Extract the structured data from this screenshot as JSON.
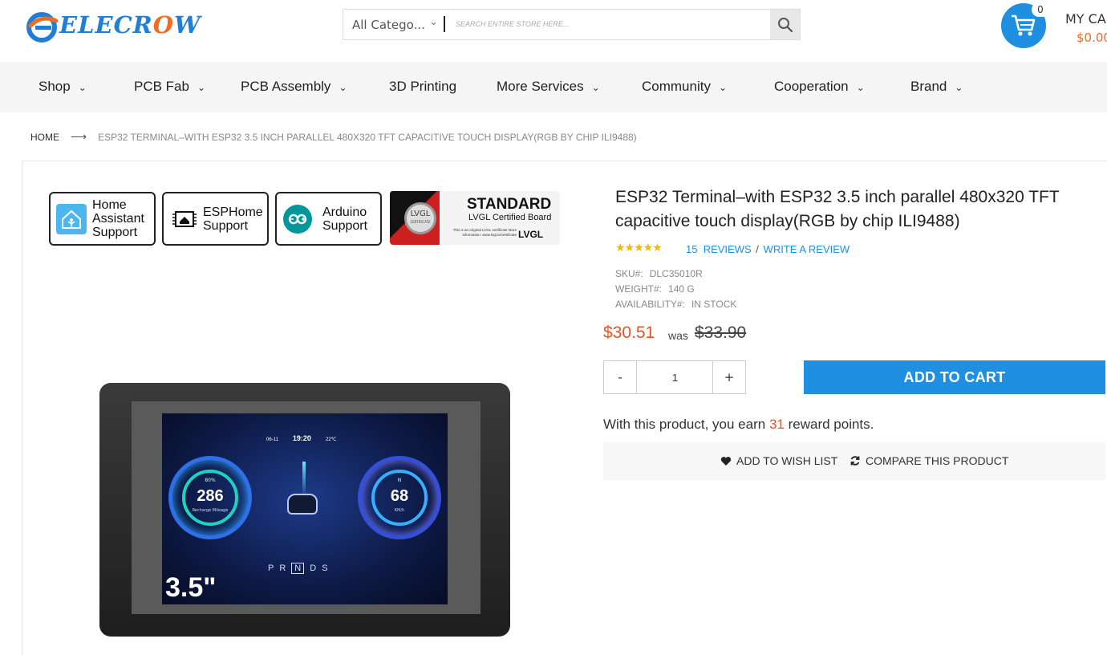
{
  "brand": {
    "logo_text_pre": "ELECR",
    "logo_text_o": "O",
    "logo_text_post": "W",
    "accent": "#1e8fe1",
    "orange": "#f26a21"
  },
  "search": {
    "category": "All Catego...",
    "placeholder": "SEARCH ENTIRE STORE HERE..."
  },
  "cart": {
    "count": "0",
    "label": "MY CA",
    "total": "$0.00"
  },
  "nav": [
    {
      "label": "Shop",
      "has_menu": true
    },
    {
      "label": "PCB Fab",
      "has_menu": true
    },
    {
      "label": "PCB Assembly",
      "has_menu": true
    },
    {
      "label": "3D Printing",
      "has_menu": false
    },
    {
      "label": "More Services",
      "has_menu": true
    },
    {
      "label": "Community",
      "has_menu": true
    },
    {
      "label": "Cooperation",
      "has_menu": true
    },
    {
      "label": "Brand",
      "has_menu": true
    }
  ],
  "breadcrumb": {
    "home": "HOME",
    "current": "ESP32 TERMINAL–WITH ESP32 3.5 INCH PARALLEL 480X320 TFT CAPACITIVE TOUCH DISPLAY(RGB BY CHIP ILI9488)"
  },
  "badges": [
    {
      "icon": "home-assistant-icon",
      "line1": "Home",
      "line2": "Assistant",
      "line3": "Support"
    },
    {
      "icon": "esphome-icon",
      "line1": "ESPHome",
      "line2": "Support"
    },
    {
      "icon": "arduino-icon",
      "line1": "Arduino",
      "line2": "Support"
    }
  ],
  "lvgl_badge": {
    "circle": "LVGL",
    "circle_sub": "CERTIFICATE",
    "title": "STANDARD",
    "subtitle": "LVGL Certified Board",
    "fine_print": "This is an original LVGL certificate More information: www.lvgl.io/certificate",
    "brand": "LVGL"
  },
  "device_screen": {
    "date": "06-11",
    "time": "19:20",
    "temp": "22℃",
    "left_value": "286",
    "left_pct": "80%",
    "left_sub": "Recharge Mileage",
    "right_value": "68",
    "right_top": "N",
    "right_sub": "KM/h",
    "gear_p": "P",
    "gear_r": "R",
    "gear_n": "N",
    "gear_d": "D",
    "gear_s": "S",
    "size_label": "3.5\""
  },
  "product": {
    "title": "ESP32 Terminal–with ESP32 3.5 inch parallel 480x320 TFT capacitive touch display(RGB by chip ILI9488)",
    "rating": 5,
    "stars": "★★★★★",
    "reviews_count": "15",
    "reviews_label": "REVIEWS",
    "separator": "/",
    "write_review": "WRITE A REVIEW",
    "sku_label": "SKU#:",
    "sku": "DLC35010R",
    "weight_label": "WEIGHT#:",
    "weight": "140 G",
    "availability_label": "AVAILABILITY#:",
    "availability": "IN STOCK",
    "price": "$30.51",
    "was_label": "was",
    "old_price": "$33.90",
    "qty_minus": "-",
    "qty_value": "1",
    "qty_plus": "+",
    "add_to_cart": "ADD TO CART",
    "reward_pre": "With this product, you earn",
    "reward_points": "31",
    "reward_post": "reward points.",
    "wishlist": "ADD TO WISH LIST",
    "compare": "COMPARE THIS PRODUCT"
  }
}
